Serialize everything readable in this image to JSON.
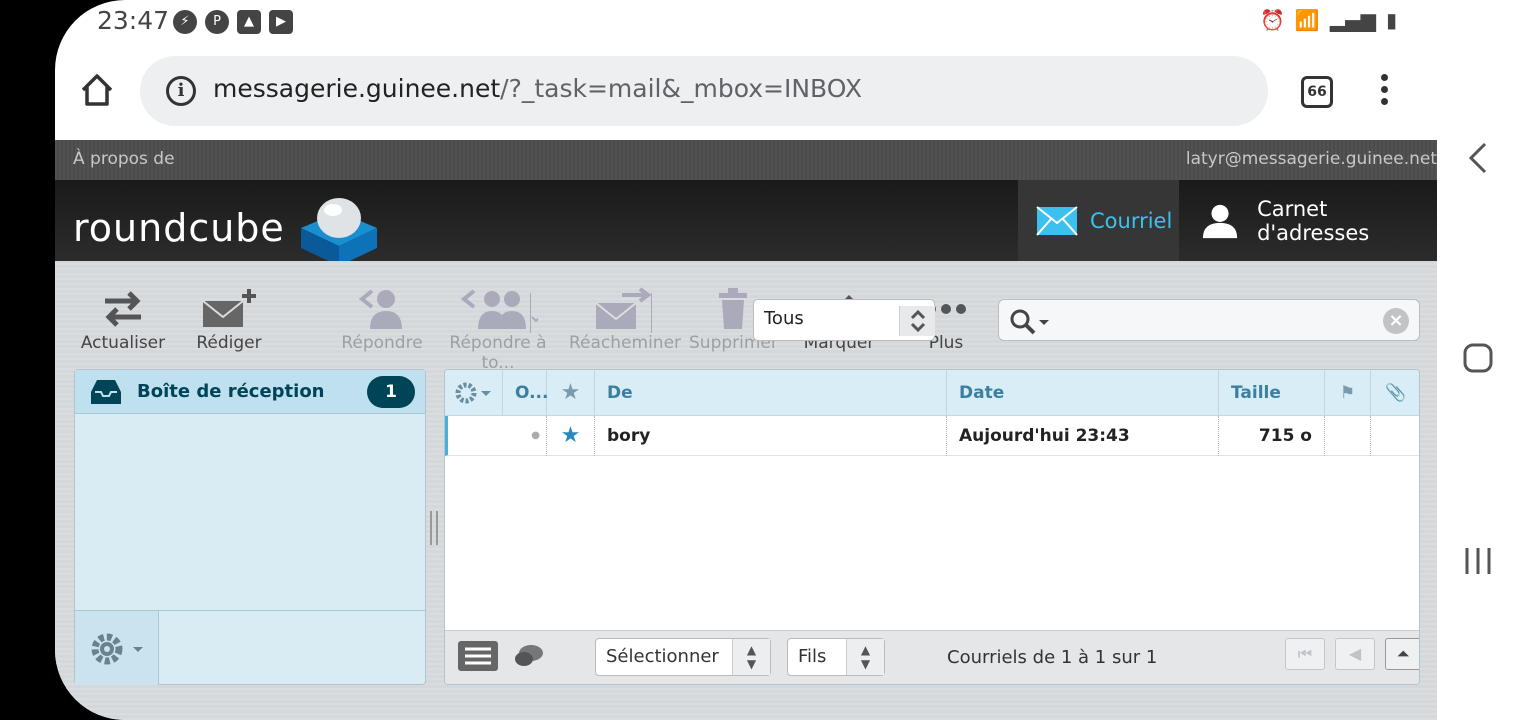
{
  "status_bar": {
    "time": "23:47"
  },
  "browser": {
    "url_host": "messagerie.guinee.net",
    "url_rest": "/?_task=mail&_mbox=INBOX",
    "tab_count": "66"
  },
  "topline": {
    "about": "À propos de",
    "user": "latyr@messagerie.guinee.net"
  },
  "header": {
    "logo": "roundcube",
    "tasks": [
      {
        "label": "Courriel"
      },
      {
        "label": "Carnet d'adresses"
      }
    ]
  },
  "toolbar": {
    "refresh": "Actualiser",
    "compose": "Rédiger",
    "reply": "Répondre",
    "reply_all": "Répondre à to...",
    "forward": "Réacheminer",
    "delete": "Supprimer",
    "mark": "Marquer",
    "more": "Plus"
  },
  "filter": {
    "value": "Tous"
  },
  "folders": {
    "items": [
      {
        "name": "Boîte de réception",
        "unread": "1"
      }
    ]
  },
  "message_list": {
    "columns": {
      "options": "O...",
      "from": "De",
      "date": "Date",
      "size": "Taille"
    },
    "rows": [
      {
        "from": "bory",
        "date": "Aujourd'hui 23:43",
        "size": "715 o"
      }
    ],
    "footer": {
      "select": "Sélectionner",
      "threads": "Fils",
      "count": "Courriels de 1 à 1 sur 1"
    }
  },
  "colors": {
    "accent": "#3cc0f0",
    "folder_badge": "#004458",
    "header_bg": "#1f1f1f"
  }
}
